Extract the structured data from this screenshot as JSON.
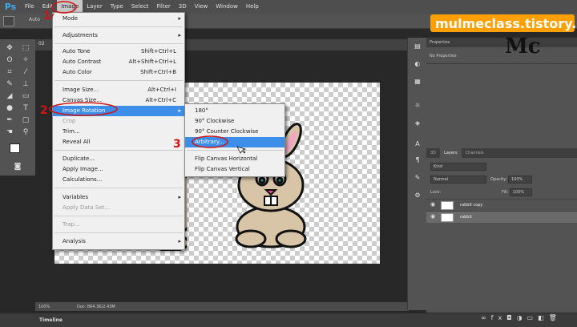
{
  "app": {
    "logo": "Ps"
  },
  "menubar": [
    "File",
    "Edit",
    "Image",
    "Layer",
    "Type",
    "Select",
    "Filter",
    "3D",
    "View",
    "Window",
    "Help"
  ],
  "options": {
    "auto_label": "Auto"
  },
  "doc": {
    "tab": "02 ",
    "zoom": "100%",
    "doc_size": "Doc: 864.3K/2.43M"
  },
  "image_menu": [
    {
      "label": "Mode",
      "arrow": "▸"
    },
    {
      "label": "Adjustments",
      "arrow": "▸"
    },
    {
      "label": "Auto Tone",
      "shortcut": "Shift+Ctrl+L"
    },
    {
      "label": "Auto Contrast",
      "shortcut": "Alt+Shift+Ctrl+L"
    },
    {
      "label": "Auto Color",
      "shortcut": "Shift+Ctrl+B"
    },
    {
      "label": "Image Size...",
      "shortcut": "Alt+Ctrl+I"
    },
    {
      "label": "Canvas Size...",
      "shortcut": "Alt+Ctrl+C"
    },
    {
      "label": "Image Rotation",
      "arrow": "▸"
    },
    {
      "label": "Crop"
    },
    {
      "label": "Trim..."
    },
    {
      "label": "Reveal All"
    },
    {
      "label": "Duplicate..."
    },
    {
      "label": "Apply Image..."
    },
    {
      "label": "Calculations..."
    },
    {
      "label": "Variables",
      "arrow": "▸"
    },
    {
      "label": "Apply Data Set..."
    },
    {
      "label": "Trap..."
    },
    {
      "label": "Analysis",
      "arrow": "▸"
    }
  ],
  "rotation_menu": [
    "180°",
    "90° Clockwise",
    "90° Counter Clockwise",
    "Arbitrary...",
    "Flip Canvas Horizontal",
    "Flip Canvas Vertical"
  ],
  "annotations": {
    "n1": "1",
    "n2": "2",
    "n3": "3"
  },
  "panels": {
    "properties_tab": "Properties",
    "no_properties": "No Properties",
    "tabs": [
      "3D",
      "Layers",
      "Channels"
    ],
    "kind": "Kind",
    "blend": "Normal",
    "opacity_label": "Opacity:",
    "opacity": "100%",
    "lock_label": "Lock:",
    "fill_label": "Fill:",
    "fill": "100%"
  },
  "layers": [
    {
      "name": "rabbit copy"
    },
    {
      "name": "rabbit"
    }
  ],
  "timeline": {
    "label": "Timeline"
  },
  "overlay": {
    "blog": "mulmeclass.tistory.com",
    "sign": "Mc"
  }
}
